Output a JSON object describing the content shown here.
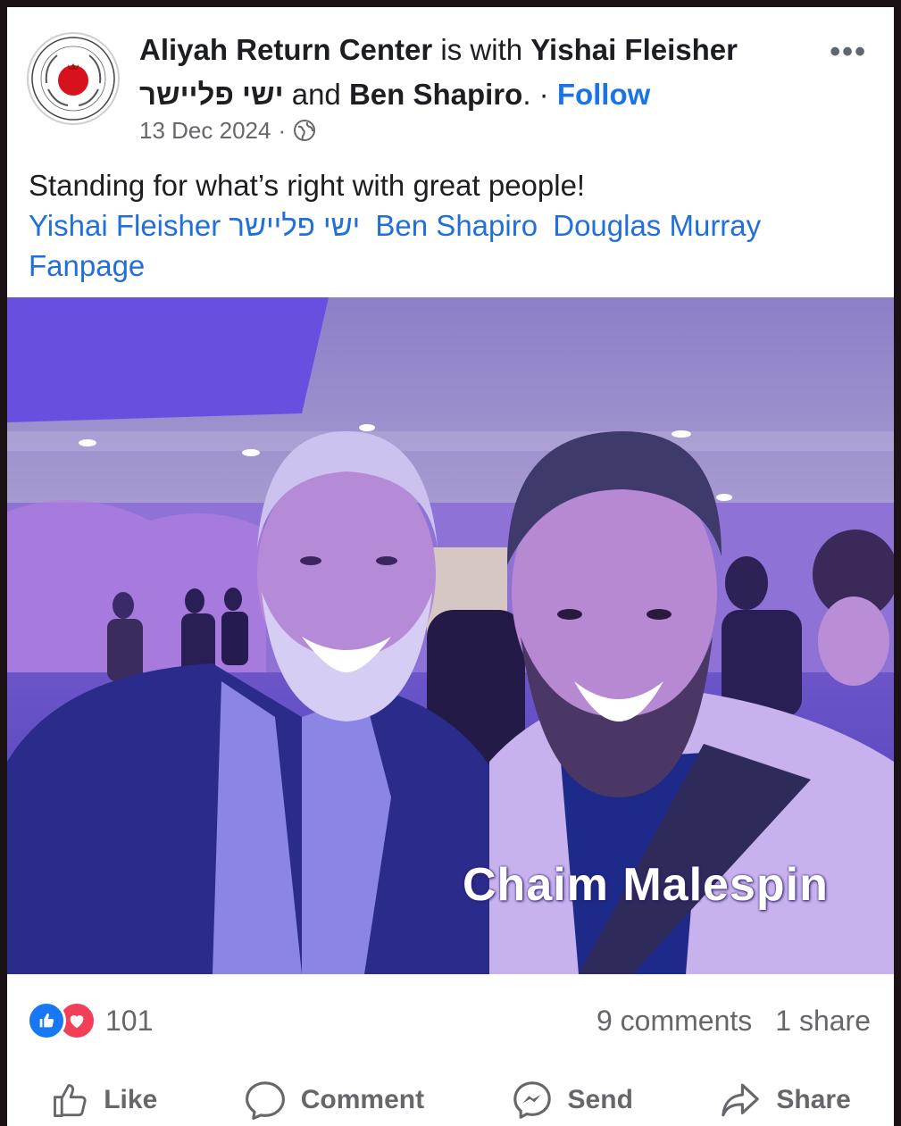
{
  "post": {
    "page_name": "Aliyah Return Center",
    "with_text": " is with ",
    "tagged_1": "Yishai Fleisher",
    "tagged_1_hebrew": "ישי פליישר",
    "and_text": " and ",
    "tagged_2": "Ben Shapiro",
    "period": ".",
    "separator": " · ",
    "follow_label": "Follow",
    "date": "13 Dec 2024",
    "date_separator": "·",
    "audience_icon": "globe-icon",
    "more_icon": "more-options-icon",
    "text": "Standing for what’s right with great people!",
    "tags": [
      "Yishai Fleisher ישי פליישר",
      "Ben Shapiro",
      "Douglas Murray Fanpage"
    ],
    "photo_watermark": "Chaim Malespin"
  },
  "engagement": {
    "reaction_count": "101",
    "comments": "9 comments",
    "shares": "1 share",
    "reaction_icons": [
      "like-reaction-icon",
      "love-reaction-icon"
    ]
  },
  "actions": {
    "like": "Like",
    "comment": "Comment",
    "send": "Send",
    "share": "Share"
  },
  "colors": {
    "link_blue": "#1b74e4",
    "text": "#1c1e21",
    "muted": "#65676b",
    "like_blue": "#1877f2",
    "love_red": "#f33e58"
  }
}
